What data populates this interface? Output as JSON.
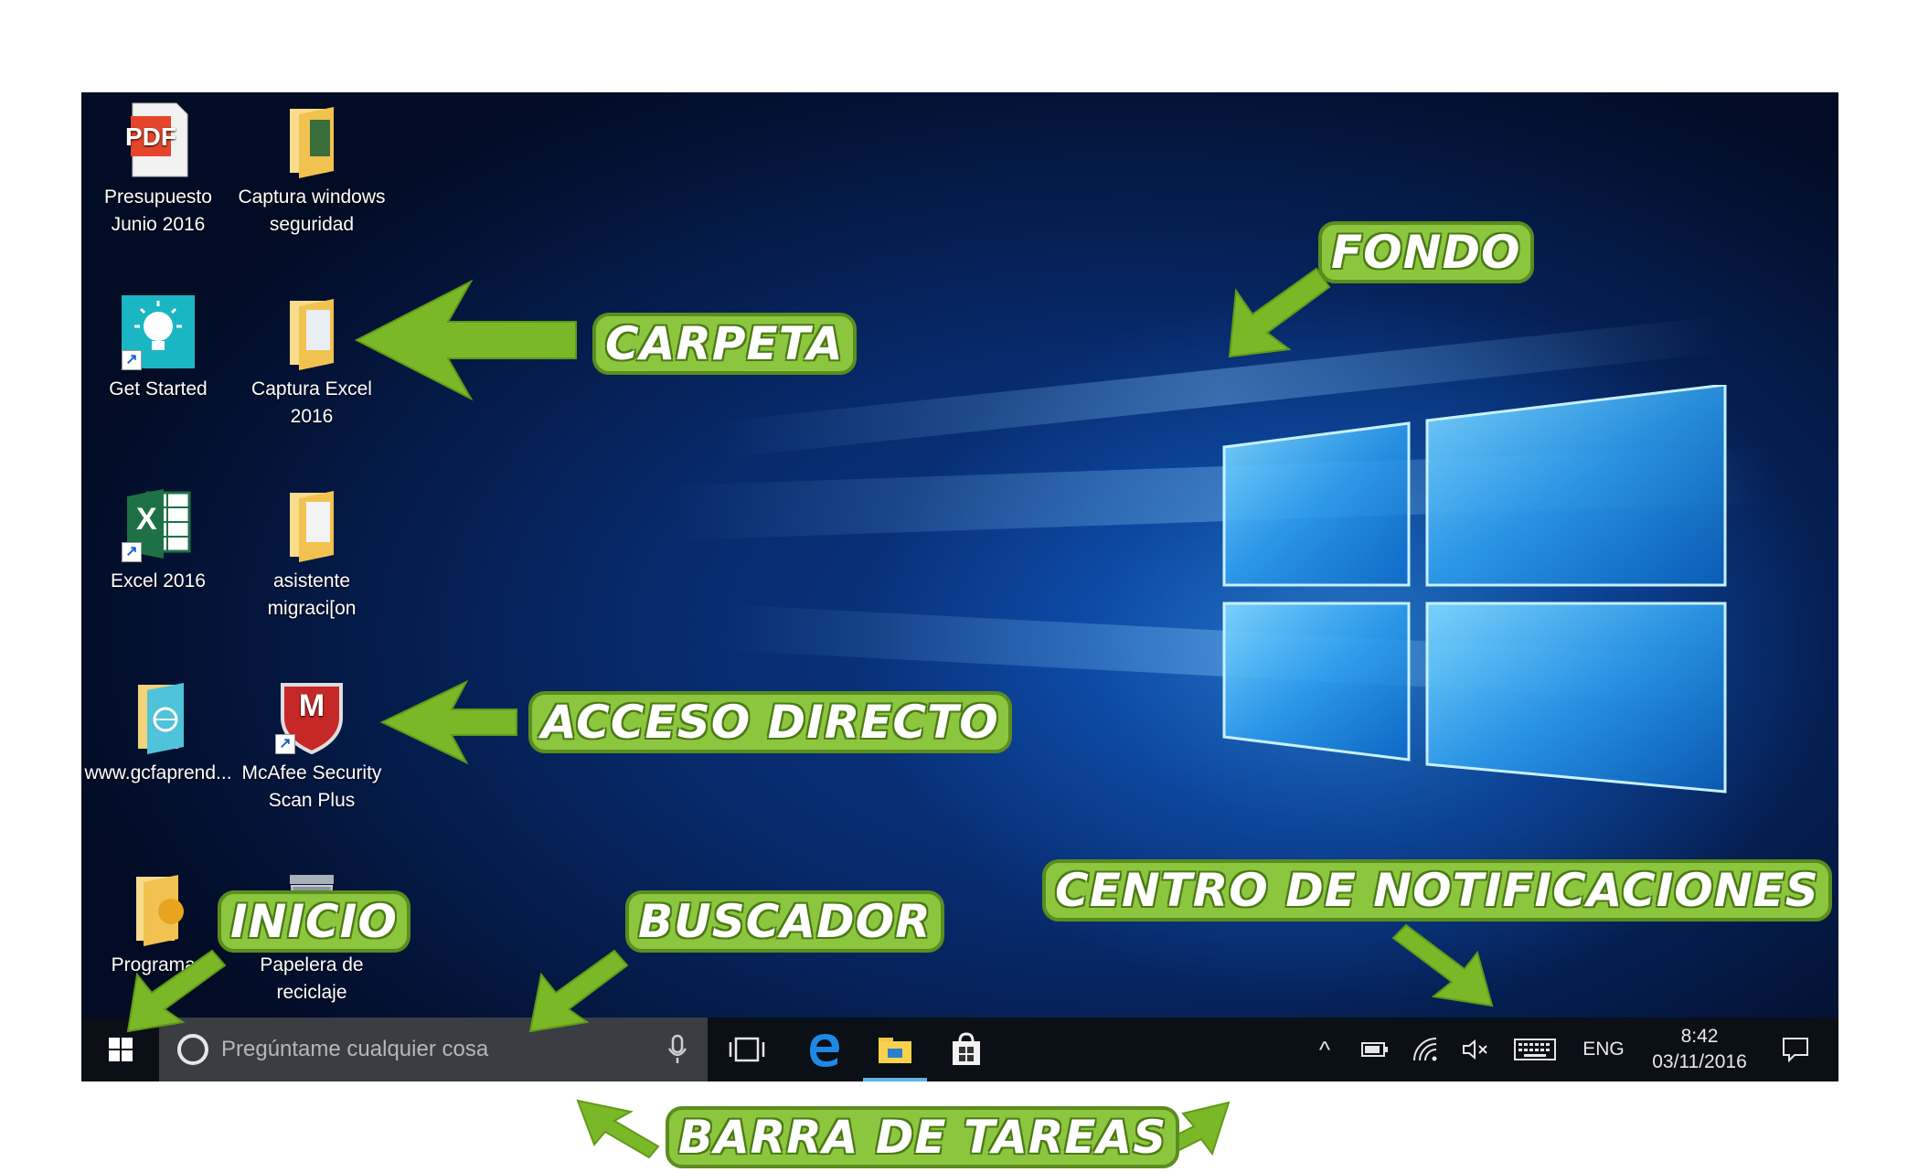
{
  "desktop": {
    "icons": [
      {
        "label": "Presupuesto\nJunio 2016",
        "icon": "pdf-document-icon"
      },
      {
        "label": "Captura windows\nseguridad",
        "icon": "folder-icon"
      },
      {
        "label": "Get Started",
        "icon": "lightbulb-icon"
      },
      {
        "label": "Captura Excel\n2016",
        "icon": "folder-icon"
      },
      {
        "label": "Excel 2016",
        "icon": "excel-icon"
      },
      {
        "label": "asistente\nmigraci[on",
        "icon": "folder-icon"
      },
      {
        "label": "www.gcfaprend...",
        "icon": "web-folder-icon"
      },
      {
        "label": "McAfee Security\nScan Plus",
        "icon": "mcafee-shield-icon"
      },
      {
        "label": "Programas",
        "icon": "programs-folder-icon"
      },
      {
        "label": "Papelera de\nreciclaje",
        "icon": "recycle-bin-icon"
      }
    ],
    "shortcut_glyph": "↗",
    "mcafee_letter": "M",
    "excel_letter": "X"
  },
  "taskbar": {
    "search_placeholder": "Pregúntame cualquier cosa",
    "tray": {
      "language": "ENG",
      "time": "8:42",
      "date": "03/11/2016",
      "chevron": "^"
    }
  },
  "callouts": {
    "fondo": "FONDO",
    "carpeta": "CARPETA",
    "acceso_directo": "ACCESO DIRECTO",
    "inicio": "INICIO",
    "buscador": "BUSCADOR",
    "centro_notificaciones": "CENTRO DE NOTIFICACIONES",
    "barra_tareas": "BARRA DE TAREAS"
  },
  "colors": {
    "callout_green": "#8cc63f",
    "arrow_green": "#7ab828",
    "taskbar": "#0b0f16",
    "active_indicator": "#5fb4e8"
  }
}
